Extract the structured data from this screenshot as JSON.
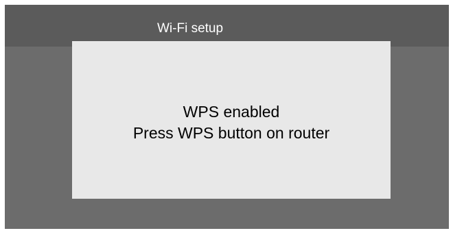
{
  "window": {
    "title": "Wi-Fi setup"
  },
  "dialog": {
    "line1": "WPS enabled",
    "line2": "Press WPS button on router"
  },
  "colors": {
    "background": "#6c6c6c",
    "title_bar": "#5b5b5b",
    "dialog": "#e8e8e8",
    "title_text": "#ffffff",
    "dialog_text": "#000000"
  }
}
